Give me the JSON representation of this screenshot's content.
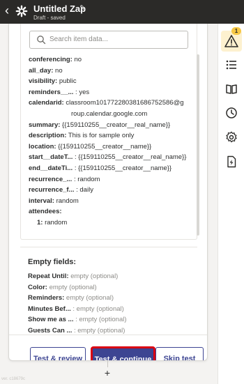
{
  "header": {
    "title": "Untitled Zap",
    "status": "Draft - saved"
  },
  "search": {
    "placeholder": "Search item data..."
  },
  "fields": [
    {
      "key": "conferencing:",
      "value": " no"
    },
    {
      "key": "all_day:",
      "value": " no"
    },
    {
      "key": "visibility:",
      "value": " public"
    },
    {
      "key": "reminders__...",
      "value": " : yes"
    },
    {
      "key": "calendarid:",
      "value": " classroom101772280381686752586@g",
      "value2": "roup.calendar.google.com"
    },
    {
      "key": "summary:",
      "value": " {{159110255__creator__real_name}}"
    },
    {
      "key": "description:",
      "value": " This is for sample only"
    },
    {
      "key": "location:",
      "value": " {{159110255__creator__name}}"
    },
    {
      "key": "start__dateT...",
      "value": " : {{159110255__creator__real_name}}"
    },
    {
      "key": "end__dateTi...",
      "value": " : {{159110255__creator__name}}"
    },
    {
      "key": "recurrence_...",
      "value": " : random"
    },
    {
      "key": "recurrence_f...",
      "value": " : daily"
    },
    {
      "key": "interval:",
      "value": " random"
    },
    {
      "key": "attendees:",
      "value": ""
    },
    {
      "key": "1:",
      "value": " random"
    }
  ],
  "empty_fields": {
    "title": "Empty fields:",
    "items": [
      {
        "key": "Repeat Until:",
        "value": " empty (optional)"
      },
      {
        "key": "Color:",
        "value": " empty (optional)"
      },
      {
        "key": "Reminders:",
        "value": " empty (optional)"
      },
      {
        "key": "Minutes Bef...",
        "value": " : empty (optional)"
      },
      {
        "key": "Show me as ...",
        "value": " : empty (optional)"
      },
      {
        "key": "Guests Can ...",
        "value": " : empty (optional)"
      }
    ]
  },
  "buttons": {
    "test_review": "Test & review",
    "test_continue": "Test & continue",
    "skip_test": "Skip test"
  },
  "canvas": {
    "add_step": "+",
    "version": "ver. c18679c"
  },
  "sidebar": {
    "warning_badge": "1",
    "icons": [
      "warning-icon",
      "list-icon",
      "book-icon",
      "clock-icon",
      "gear-icon",
      "bolt-file-icon"
    ]
  },
  "colors": {
    "topbar": "#2b2a28",
    "primary": "#3d4592",
    "highlight": "#d90012",
    "warning": "#f7c844"
  }
}
